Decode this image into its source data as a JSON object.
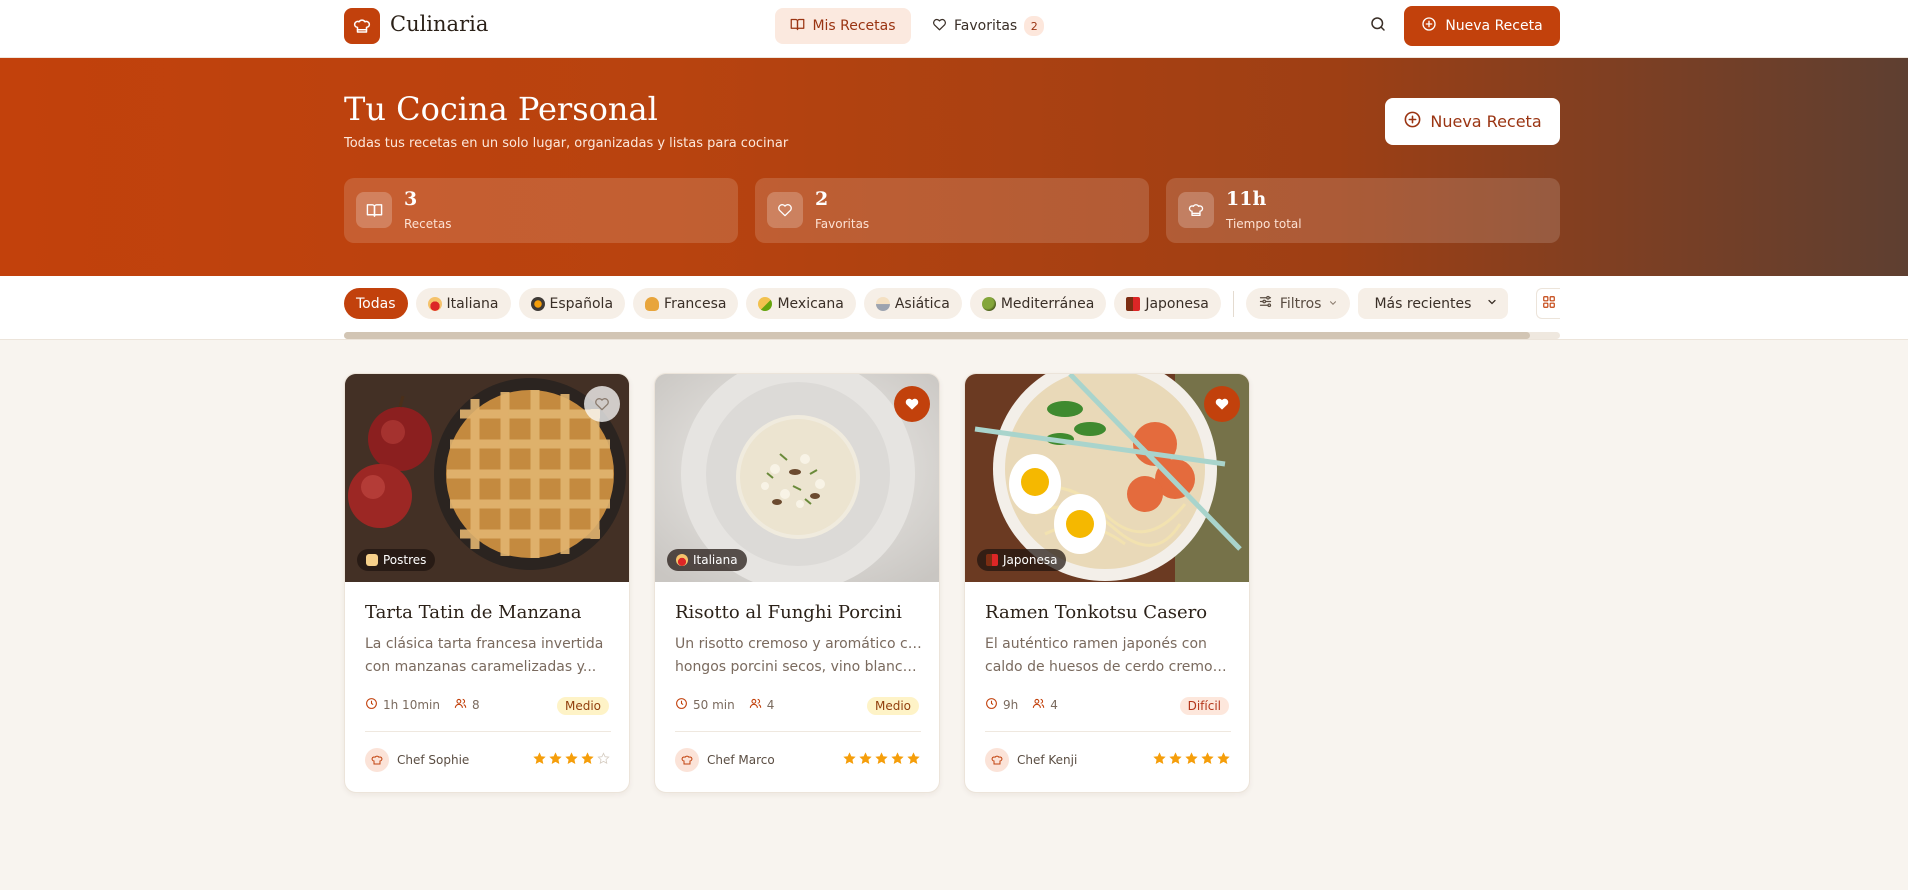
{
  "app": {
    "name": "Culinaria"
  },
  "nav": {
    "mis_recetas": "Mis Recetas",
    "favoritas": "Favoritas",
    "favoritas_count": "2",
    "nueva_receta": "Nueva Receta"
  },
  "hero": {
    "title": "Tu Cocina Personal",
    "subtitle": "Todas tus recetas en un solo lugar, organizadas y listas para cocinar",
    "button": "Nueva Receta",
    "stats": [
      {
        "value": "3",
        "label": "Recetas",
        "icon": "book-icon"
      },
      {
        "value": "2",
        "label": "Favoritas",
        "icon": "heart-icon"
      },
      {
        "value": "11h",
        "label": "Tiempo total",
        "icon": "chef-hat-icon"
      }
    ]
  },
  "filters": {
    "categories": [
      {
        "label": "Todas",
        "active": true
      },
      {
        "label": "Italiana",
        "icon": "pasta-icon"
      },
      {
        "label": "Española",
        "icon": "paella-icon"
      },
      {
        "label": "Francesa",
        "icon": "croissant-icon"
      },
      {
        "label": "Mexicana",
        "icon": "taco-icon"
      },
      {
        "label": "Asiática",
        "icon": "noodles-icon"
      },
      {
        "label": "Mediterránea",
        "icon": "olive-icon"
      },
      {
        "label": "Japonesa",
        "icon": "bento-icon"
      }
    ],
    "filtros_label": "Filtros",
    "sort_value": "Más recientes"
  },
  "recipes": [
    {
      "title": "Tarta Tatin de Manzana",
      "tag": "Postres",
      "desc_line1": "La clásica tarta francesa invertida",
      "desc_line2": "con manzanas caramelizadas y...",
      "time": "1h 10min",
      "servings": "8",
      "difficulty": "Medio",
      "chef": "Chef Sophie",
      "rating": 4,
      "favorite": false
    },
    {
      "title": "Risotto al Funghi Porcini",
      "tag": "Italiana",
      "desc_line1": "Un risotto cremoso y aromático con",
      "desc_line2": "hongos porcini secos, vino blanco ...",
      "time": "50 min",
      "servings": "4",
      "difficulty": "Medio",
      "chef": "Chef Marco",
      "rating": 5,
      "favorite": true
    },
    {
      "title": "Ramen Tonkotsu Casero",
      "tag": "Japonesa",
      "desc_line1": "El auténtico ramen japonés con",
      "desc_line2": "caldo de huesos de cerdo cremos...",
      "time": "9h",
      "servings": "4",
      "difficulty": "Difícil",
      "chef": "Chef Kenji",
      "rating": 5,
      "favorite": true
    }
  ],
  "colors": {
    "accent": "#c2410c",
    "star": "#f59e0b",
    "background": "#f8f4ef"
  }
}
